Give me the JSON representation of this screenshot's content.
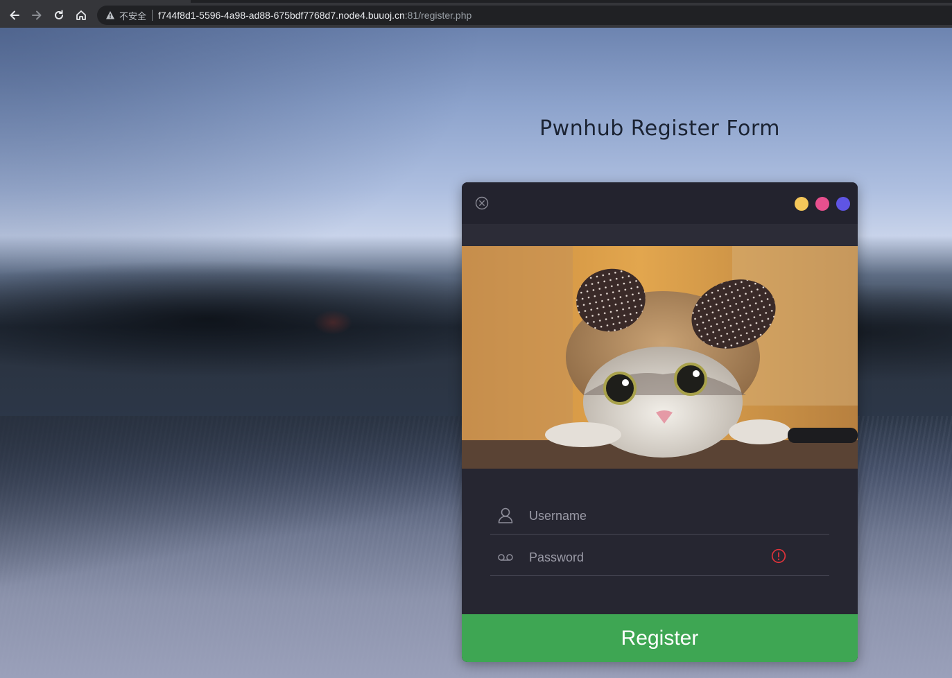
{
  "browser": {
    "security_label": "不安全",
    "url_host": "f744f8d1-5596-4a98-ad88-675bdf7768d7.node4.buuoj.cn",
    "url_path": ":81/register.php",
    "icons": [
      "back-icon",
      "forward-icon",
      "reload-icon",
      "home-icon",
      "warning-icon"
    ]
  },
  "page": {
    "title": "Pwnhub Register Form"
  },
  "card": {
    "window_dots": [
      {
        "name": "yellow",
        "color": "#f5c75a"
      },
      {
        "name": "pink",
        "color": "#e8508e"
      },
      {
        "name": "purple",
        "color": "#5f55e4"
      }
    ],
    "photo_subject": "kitten wearing a bear-ear hat",
    "username_placeholder": "Username",
    "password_placeholder": "Password",
    "register_label": "Register",
    "colors": {
      "card_bg": "#262631",
      "button": "#3ea653",
      "alert": "#e0333a"
    }
  }
}
